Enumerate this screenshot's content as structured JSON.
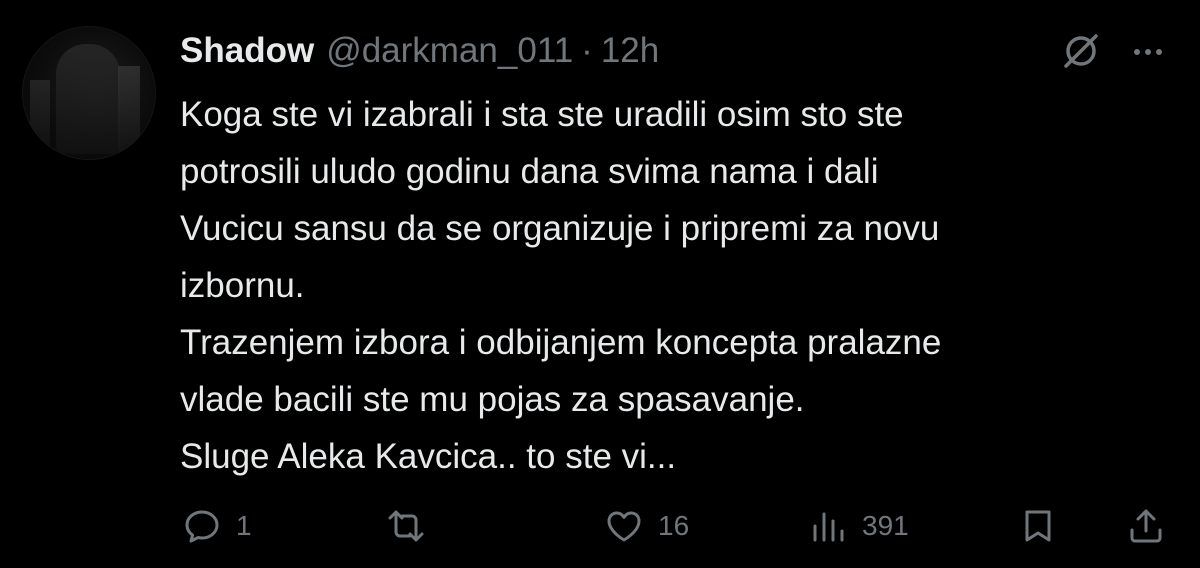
{
  "author": {
    "display_name": "Shadow",
    "handle": "@darkman_011",
    "separator": "·",
    "time": "12h"
  },
  "body_lines": [
    "Koga ste vi izabrali i sta ste uradili osim sto ste",
    "potrosili uludo godinu dana svima nama i  dali",
    "Vucicu sansu da se organizuje i pripremi za novu",
    "izbornu.",
    "Trazenjem izbora i odbijanjem koncepta pralazne",
    "vlade bacili ste mu pojas za spasavanje.",
    "Sluge Aleka Kavcica.. to ste vi..."
  ],
  "actions": {
    "replies": "1",
    "reposts": "",
    "likes": "16",
    "views": "391"
  },
  "icons": {
    "grok": "grok-icon",
    "more": "more-icon",
    "reply": "reply-icon",
    "repost": "repost-icon",
    "like": "like-icon",
    "views": "views-icon",
    "bookmark": "bookmark-icon",
    "share": "share-icon"
  },
  "colors": {
    "background": "#000000",
    "primary_text": "#e7e9ea",
    "secondary_text": "#71767b"
  }
}
